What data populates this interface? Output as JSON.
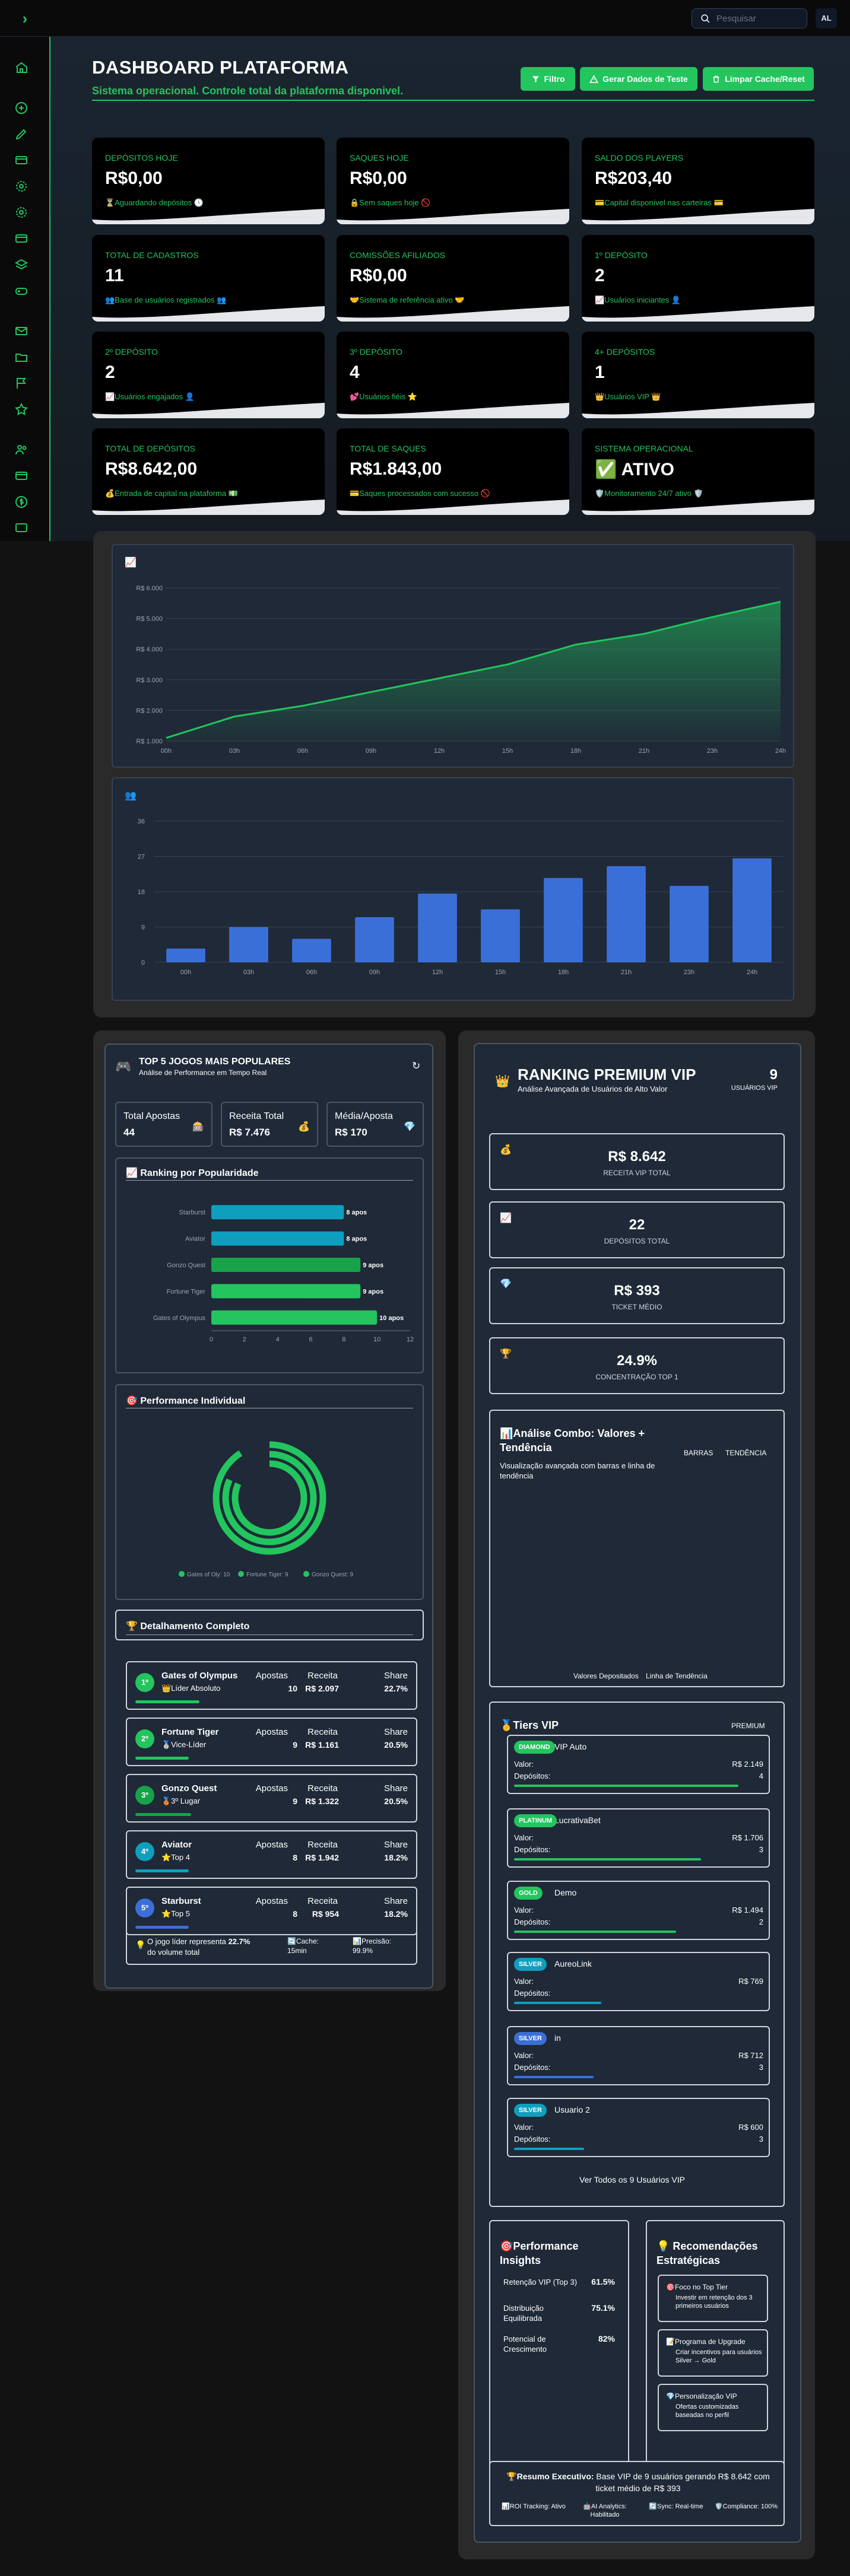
{
  "search": {
    "placeholder": "Pesquisar"
  },
  "user": {
    "initials": "AL"
  },
  "header": {
    "title": "DASHBOARD PLATAFORMA",
    "subtitle": "Sistema operacional. Controle total da plataforma disponivel.",
    "buttons": {
      "filter": "Filtro",
      "generate": "Gerar Dados de Teste",
      "clear": "Limpar Cache/Reset"
    }
  },
  "stat_cards": [
    {
      "label": "DEPÓSITOS HOJE",
      "value": "R$0,00",
      "desc": "⏳Aguardando depósitos 🕓"
    },
    {
      "label": "SAQUES HOJE",
      "value": "R$0,00",
      "desc": "🔒Sem saques hoje 🚫"
    },
    {
      "label": "SALDO DOS PLAYERS",
      "value": "R$203,40",
      "desc": "💳Capital disponível nas carteiras 💳"
    },
    {
      "label": "TOTAL DE CADASTROS",
      "value": "11",
      "desc": "👥Base de usuários registrados 👥"
    },
    {
      "label": "COMISSÕES AFILIADOS",
      "value": "R$0,00",
      "desc": "🤝Sistema de referência ativo 🤝"
    },
    {
      "label": "1º DEPÓSITO",
      "value": "2",
      "desc": "📈Usuários iniciantes 👤"
    },
    {
      "label": "2º DEPÓSITO",
      "value": "2",
      "desc": "📈Usuários engajados 👤"
    },
    {
      "label": "3º DEPÓSITO",
      "value": "4",
      "desc": "💕Usuários fiéis ⭐"
    },
    {
      "label": "4+ DEPÓSITOS",
      "value": "1",
      "desc": "👑Usuários VIP 👑"
    },
    {
      "label": "TOTAL DE DEPÓSITOS",
      "value": "R$8.642,00",
      "desc": "💰Entrada de capital na plataforma 💵"
    },
    {
      "label": "TOTAL DE SAQUES",
      "value": "R$1.843,00",
      "desc": "💳Saques processados com sucesso 🚫"
    },
    {
      "label": "SISTEMA OPERACIONAL",
      "value": "✅ ATIVO",
      "desc": "🛡️Monitoramento 24/7 ativo 🛡️"
    }
  ],
  "colors": {
    "accent": "#22c55e",
    "blue": "#3b6fd8",
    "teal": "#0e9fbf"
  },
  "chart_data": [
    {
      "type": "area",
      "title": "",
      "x": [
        "00h",
        "03h",
        "06h",
        "09h",
        "12h",
        "15h",
        "18h",
        "21h",
        "23h",
        "24h"
      ],
      "y_ticks": [
        "R$ 6.000",
        "R$ 5.000",
        "R$ 4.000",
        "R$ 3.000",
        "R$ 2.000",
        "R$ 1.000"
      ],
      "values": [
        1100,
        1800,
        2150,
        2600,
        3050,
        3500,
        4150,
        4500,
        5050,
        5550
      ],
      "ylim": [
        1000,
        6000
      ],
      "grid": true
    },
    {
      "type": "bar",
      "title": "",
      "categories": [
        "00h",
        "03h",
        "06h",
        "09h",
        "12h",
        "15h",
        "18h",
        "21h",
        "23h",
        "24h"
      ],
      "values": [
        3.5,
        9,
        6,
        11.5,
        17.5,
        13.5,
        21.5,
        24.5,
        19.5,
        26.5
      ],
      "y_ticks": [
        "36",
        "27",
        "18",
        "9",
        "0"
      ],
      "ylim": [
        0,
        36
      ],
      "grid": true
    },
    {
      "type": "bar",
      "title": "Ranking por Popularidade",
      "categories": [
        "Starburst",
        "Aviator",
        "Gonzo Quest",
        "Fortune Tiger",
        "Gates of Olympus"
      ],
      "values": [
        8,
        8,
        9,
        9,
        10
      ],
      "labels": [
        "8 apos",
        "8 apos",
        "9 apos",
        "9 apos",
        "10 apos"
      ],
      "x_ticks": [
        "0",
        "2",
        "4",
        "6",
        "8",
        "10",
        "12"
      ],
      "xlim": [
        0,
        12
      ]
    },
    {
      "type": "pie",
      "title": "Performance Individual",
      "legend": [
        "Gates of Oly: 10",
        "Fortune Tiger: 9",
        "Gonzo Quest: 9"
      ],
      "values": [
        10,
        9,
        9
      ]
    }
  ],
  "chart_icons": {
    "area": "📈",
    "bar": "👥"
  },
  "games": {
    "title": "TOP 5 JOGOS MAIS POPULARES",
    "subtitle": "Análise de Performance em Tempo Real",
    "refresh_icon": "refresh-icon",
    "summary": [
      {
        "label": "Total Apostas",
        "value": "44",
        "icon": "🎰"
      },
      {
        "label": "Receita Total",
        "value": "R$ 7.476",
        "icon": "💰"
      },
      {
        "label": "Média/Aposta",
        "value": "R$ 170",
        "icon": "💎"
      }
    ],
    "ranking_title": "📈 Ranking por Popularidade",
    "performance_title": "🎯 Performance Individual",
    "detail_title": "🏆 Detalhamento Completo",
    "col_labels": [
      "Apostas",
      "Receita",
      "Share"
    ],
    "items": [
      {
        "rank": "1º",
        "name": "Gates of Olympus",
        "tag": "👑Líder Absoluto",
        "bets": "10",
        "revenue": "R$ 2.097",
        "share": "22.7%"
      },
      {
        "rank": "2º",
        "name": "Fortune Tiger",
        "tag": "🥈Vice-Líder",
        "bets": "9",
        "revenue": "R$ 1.161",
        "share": "20.5%"
      },
      {
        "rank": "3º",
        "name": "Gonzo Quest",
        "tag": "🥉3º Lugar",
        "bets": "9",
        "revenue": "R$ 1.322",
        "share": "20.5%"
      },
      {
        "rank": "4º",
        "name": "Aviator",
        "tag": "⭐Top 4",
        "bets": "8",
        "revenue": "R$ 1.942",
        "share": "18.2%"
      },
      {
        "rank": "5º",
        "name": "Starburst",
        "tag": "⭐Top 5",
        "bets": "8",
        "revenue": "R$ 954",
        "share": "18.2%"
      }
    ],
    "footer": {
      "text_pre": "O jogo líder representa ",
      "text_pct": "22.7%",
      "text_post": " do volume total",
      "cache": "🔄Cache: 15min",
      "precision": "📊Precisão: 99.9%"
    }
  },
  "vip": {
    "title": "RANKING PREMIUM VIP",
    "subtitle": "Análise Avançada de Usuários de Alto Valor",
    "count": "9",
    "count_label": "USUÁRIOS VIP",
    "metrics": [
      {
        "icon": "💰",
        "value": "R$ 8.642",
        "label": "RECEITA VIP TOTAL"
      },
      {
        "icon": "📈",
        "value": "22",
        "label": "DEPÓSITOS TOTAL"
      },
      {
        "icon": "💎",
        "value": "R$ 393",
        "label": "TICKET MÉDIO"
      },
      {
        "icon": "🏆",
        "value": "24.9%",
        "label": "CONCENTRAÇÃO TOP 1"
      }
    ],
    "combo": {
      "title": "📊Análise Combo: Valores + Tendência",
      "desc": "Visualização avançada com barras e linha de tendência",
      "tab_bars": "BARRAS",
      "tab_trend": "TENDÊNCIA",
      "legend_bars": "Valores Depositados",
      "legend_line": "Linha de Tendência"
    },
    "tiers_title": "🥇Tiers VIP",
    "tiers_badge": "PREMIUM",
    "value_label": "Valor:",
    "deposits_label": "Depósitos:",
    "tiers": [
      {
        "badge": "DIAMOND",
        "name": "VIP Auto",
        "value": "R$ 2.149",
        "deposits": "4",
        "color": "#22c55e",
        "fill": 0.9
      },
      {
        "badge": "PLATINUM",
        "name": "LucrativaBet",
        "value": "R$ 1.706",
        "deposits": "3",
        "color": "#22c55e",
        "fill": 0.75
      },
      {
        "badge": "GOLD",
        "name": "Demo",
        "value": "R$ 1.494",
        "deposits": "2",
        "color": "#22c55e",
        "fill": 0.65
      },
      {
        "badge": "SILVER",
        "name": "AureoLink",
        "value": "R$ 769",
        "deposits": "",
        "color": "#0e9fbf",
        "fill": 0.35
      },
      {
        "badge": "SILVER",
        "name": "in",
        "value": "R$ 712",
        "deposits": "3",
        "color": "#3b6fd8",
        "fill": 0.32
      },
      {
        "badge": "SILVER",
        "name": "Usuario 2",
        "value": "R$ 600",
        "deposits": "3",
        "color": "#0e9fbf",
        "fill": 0.28
      }
    ],
    "view_all": "Ver Todos os 9 Usuários VIP",
    "insights": {
      "title": "🎯Performance Insights",
      "rows": [
        {
          "label": "Retenção VIP (Top 3)",
          "value": "61.5%"
        },
        {
          "label": "Distribuição Equilibrada",
          "value": "75.1%"
        },
        {
          "label": "Potencial de Crescimento",
          "value": "82%"
        }
      ]
    },
    "recommendations": {
      "title": "💡 Recomendações Estratégicas",
      "items": [
        {
          "title": "🎯Foco no Top Tier",
          "desc": "Investir em retenção dos 3 primeiros usuários"
        },
        {
          "title": "📝Programa de Upgrade",
          "desc": "Criar incentivos para usuários Silver → Gold"
        },
        {
          "title": "💎Personalização VIP",
          "desc": "Ofertas customizadas baseadas no perfil"
        }
      ]
    },
    "summary": {
      "label": "🏆Resumo Executivo:",
      "text": " Base VIP de 9 usuários gerando R$ 8.642 com ticket médio de R$ 393",
      "items": [
        "📊ROI Tracking: Ativo",
        "🤖AI Analytics: Habilitado",
        "🔄Sync: Real-time",
        "🛡️Compliance: 100%"
      ]
    }
  }
}
